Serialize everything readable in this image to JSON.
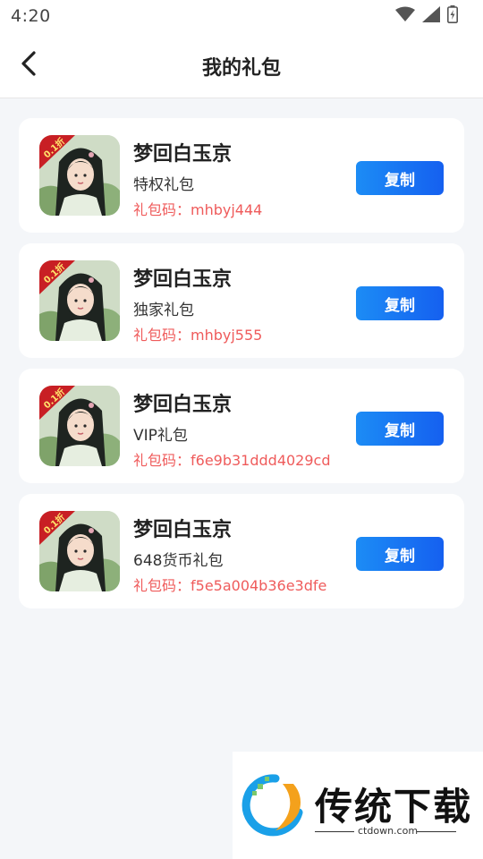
{
  "status_bar": {
    "time": "4:20",
    "icons": [
      "wifi-icon",
      "signal-icon",
      "battery-icon"
    ]
  },
  "header": {
    "title": "我的礼包",
    "back_icon": "chevron-left-icon"
  },
  "gifts": [
    {
      "game_name": "梦回白玉京",
      "gift_type": "特权礼包",
      "code": "礼包码：mhbyj444",
      "button": "复制",
      "badge": "0.1折"
    },
    {
      "game_name": "梦回白玉京",
      "gift_type": "独家礼包",
      "code": "礼包码：mhbyj555",
      "button": "复制",
      "badge": "0.1折"
    },
    {
      "game_name": "梦回白玉京",
      "gift_type": "VIP礼包",
      "code": "礼包码：f6e9b31ddd4029cd",
      "button": "复制",
      "badge": "0.1折"
    },
    {
      "game_name": "梦回白玉京",
      "gift_type": "648货币礼包",
      "code": "礼包码：f5e5a004b36e3dfe",
      "button": "复制",
      "badge": "0.1折"
    }
  ],
  "watermark": {
    "brand": "传统下载",
    "domain": "ctdown.com"
  },
  "colors": {
    "accent": "#1a73f0",
    "code_red": "#ef5b5b",
    "background": "#f4f6f9"
  }
}
